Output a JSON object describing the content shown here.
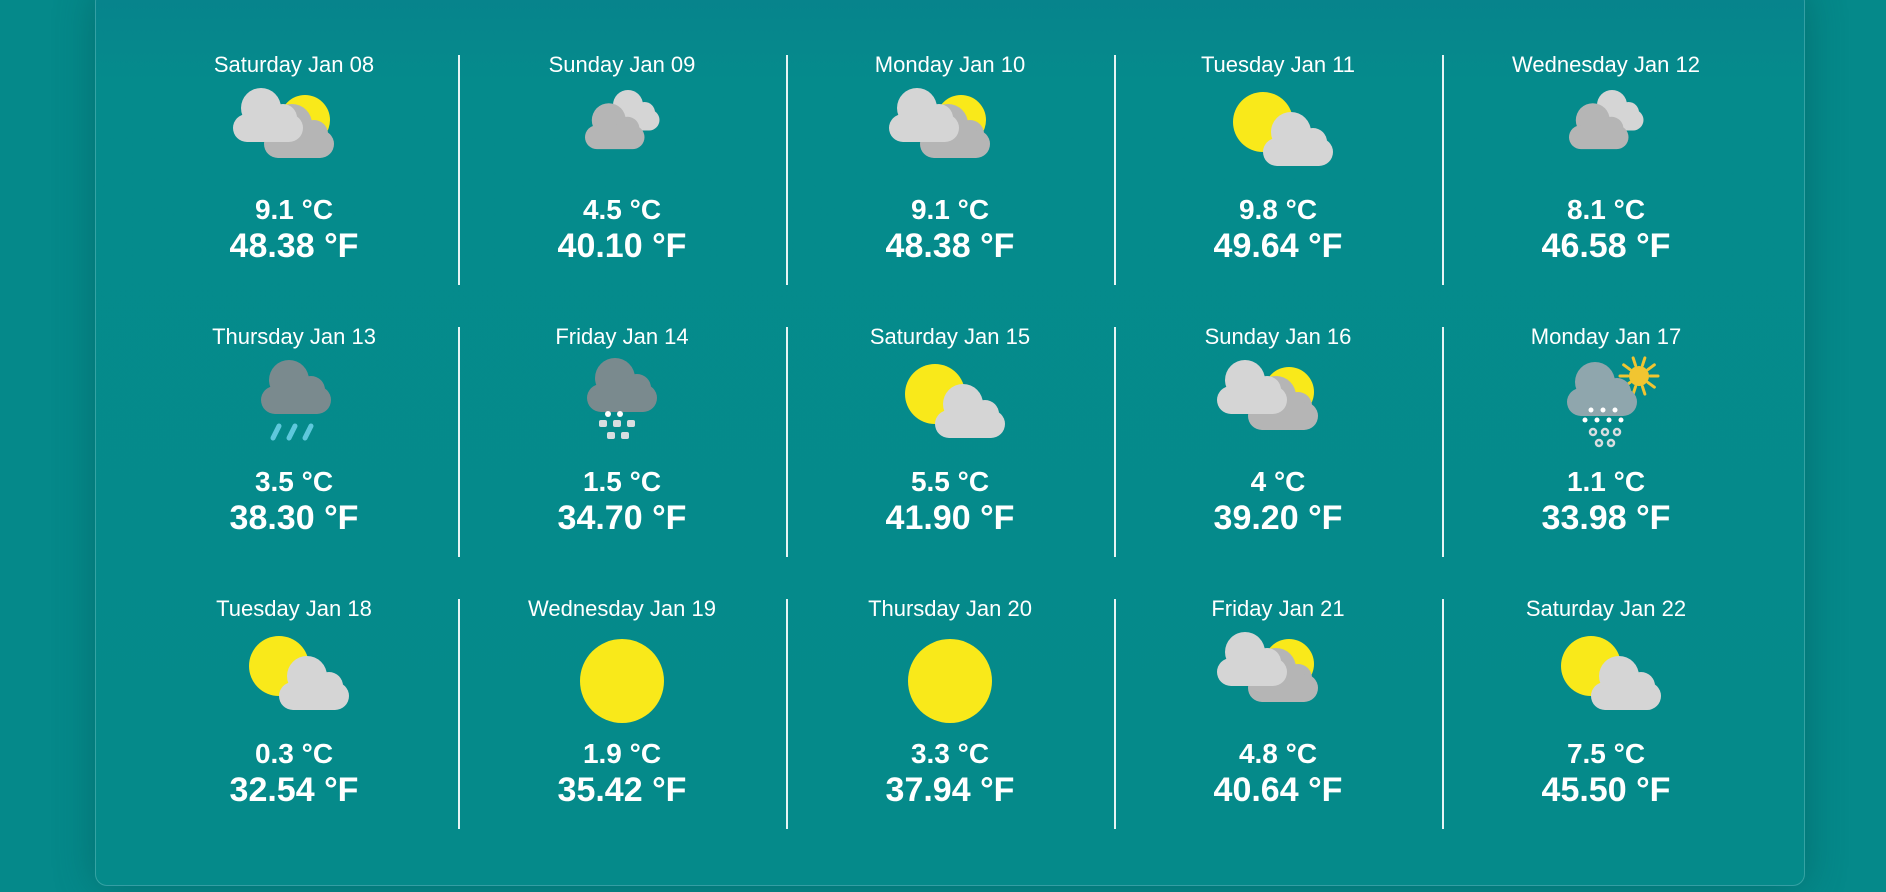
{
  "forecast": {
    "days": [
      {
        "date": "Saturday Jan 08",
        "celsius": "9.1 °C",
        "fahrenheit": "48.38 °F",
        "icon": "partly-cloudy-sun-behind-icon"
      },
      {
        "date": "Sunday Jan 09",
        "celsius": "4.5 °C",
        "fahrenheit": "40.10 °F",
        "icon": "overcast-clouds-icon"
      },
      {
        "date": "Monday Jan 10",
        "celsius": "9.1 °C",
        "fahrenheit": "48.38 °F",
        "icon": "partly-cloudy-sun-behind-icon"
      },
      {
        "date": "Tuesday Jan 11",
        "celsius": "9.8 °C",
        "fahrenheit": "49.64 °F",
        "icon": "sun-with-cloud-icon"
      },
      {
        "date": "Wednesday Jan 12",
        "celsius": "8.1 °C",
        "fahrenheit": "46.58 °F",
        "icon": "overcast-clouds-icon"
      },
      {
        "date": "Thursday Jan 13",
        "celsius": "3.5 °C",
        "fahrenheit": "38.30 °F",
        "icon": "rain-cloud-icon"
      },
      {
        "date": "Friday Jan 14",
        "celsius": "1.5 °C",
        "fahrenheit": "34.70 °F",
        "icon": "sleet-cloud-icon"
      },
      {
        "date": "Saturday Jan 15",
        "celsius": "5.5 °C",
        "fahrenheit": "41.90 °F",
        "icon": "sun-with-cloud-icon"
      },
      {
        "date": "Sunday Jan 16",
        "celsius": "4 °C",
        "fahrenheit": "39.20 °F",
        "icon": "partly-cloudy-sun-behind-icon"
      },
      {
        "date": "Monday Jan 17",
        "celsius": "1.1 °C",
        "fahrenheit": "33.98 °F",
        "icon": "snow-showers-sun-icon"
      },
      {
        "date": "Tuesday Jan 18",
        "celsius": "0.3 °C",
        "fahrenheit": "32.54 °F",
        "icon": "sun-with-cloud-icon"
      },
      {
        "date": "Wednesday Jan 19",
        "celsius": "1.9 °C",
        "fahrenheit": "35.42 °F",
        "icon": "clear-sun-icon"
      },
      {
        "date": "Thursday Jan 20",
        "celsius": "3.3 °C",
        "fahrenheit": "37.94 °F",
        "icon": "clear-sun-icon"
      },
      {
        "date": "Friday Jan 21",
        "celsius": "4.8 °C",
        "fahrenheit": "40.64 °F",
        "icon": "partly-cloudy-sun-behind-icon"
      },
      {
        "date": "Saturday Jan 22",
        "celsius": "7.5 °C",
        "fahrenheit": "45.50 °F",
        "icon": "sun-with-cloud-icon"
      }
    ]
  },
  "colors": {
    "background": "#05898a",
    "sun": "#f9e91a",
    "cloud_light": "#d5d5d5",
    "cloud_dark": "#b5b5b5",
    "cloud_storm": "#7a8a8e",
    "rain": "#5ec8dc"
  }
}
